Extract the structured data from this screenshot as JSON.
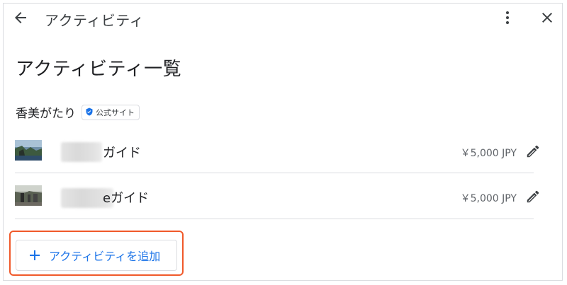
{
  "header": {
    "title": "アクティビティ",
    "back_icon": "arrow-back-icon",
    "more_icon": "more-vert-icon",
    "close_icon": "close-icon"
  },
  "main": {
    "page_title": "アクティビティ一覧",
    "provider": {
      "name": "香美がたり",
      "badge_label": "公式サイト",
      "badge_icon": "verified-shield-icon"
    },
    "activities": [
      {
        "name": "ガイド",
        "price": "￥5,000 JPY",
        "edit_icon": "pencil-icon"
      },
      {
        "name": "eガイド",
        "price": "￥5,000 JPY",
        "edit_icon": "pencil-icon"
      }
    ],
    "add_button": {
      "label": "アクティビティを追加",
      "icon": "plus-icon"
    }
  },
  "colors": {
    "accent": "#1a73e8",
    "highlight": "#f0592a",
    "divider": "#dadce0",
    "badge_shield": "#1a73e8"
  }
}
